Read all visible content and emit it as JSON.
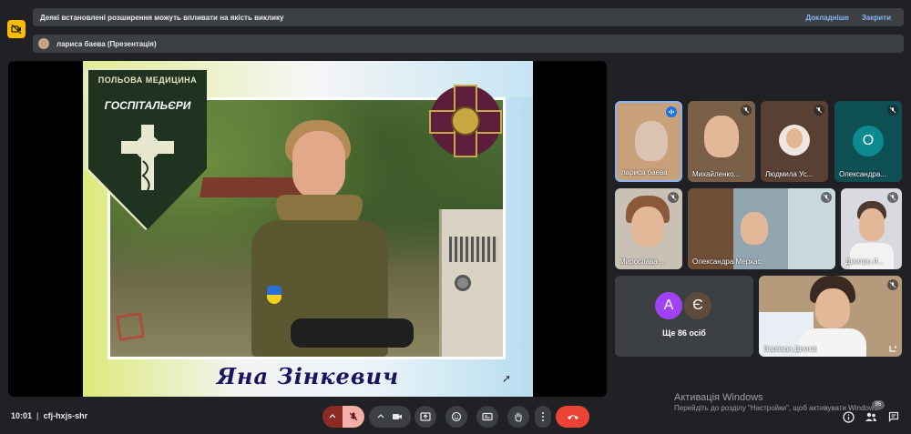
{
  "banner": {
    "warning": "Деякі встановлені розширення можуть впливати на якість виклику",
    "details_link": "Докладніше",
    "close_link": "Закрити"
  },
  "presenter": {
    "label": "лариса баева (Презентація)"
  },
  "slide": {
    "badge_title": "ПОЛЬОВА МЕДИЦИНА",
    "badge_subtitle": "ГОСПІТАЛЬЄРИ",
    "name": "Яна Зінкевич"
  },
  "participants": [
    {
      "name": "лариса баева",
      "mic": "speaking"
    },
    {
      "name": "Михайленко...",
      "mic": "muted"
    },
    {
      "name": "Людмила Ус...",
      "mic": "muted"
    },
    {
      "name": "Олександра...",
      "mic": "muted",
      "initial": "О",
      "color": "#0b8a8f"
    },
    {
      "name": "Мирослава ...",
      "mic": "muted"
    },
    {
      "name": "Олександра Мерхас",
      "mic": "muted"
    },
    {
      "name": "Дмитро Л...",
      "mic": "muted"
    },
    {
      "name": "Варвара Демків",
      "mic": "muted"
    }
  ],
  "others": {
    "initials": [
      "А",
      "Є"
    ],
    "colors": [
      "#a142f4",
      "#5f4b3c"
    ],
    "label": "Ще 86 осіб"
  },
  "watermark": {
    "title": "Активація Windows",
    "subtitle": "Перейдіть до розділу \"Настройки\", щоб активувати Windows."
  },
  "meeting": {
    "time": "10:01",
    "code": "cfj-hxjs-shr",
    "people_count": "95"
  }
}
